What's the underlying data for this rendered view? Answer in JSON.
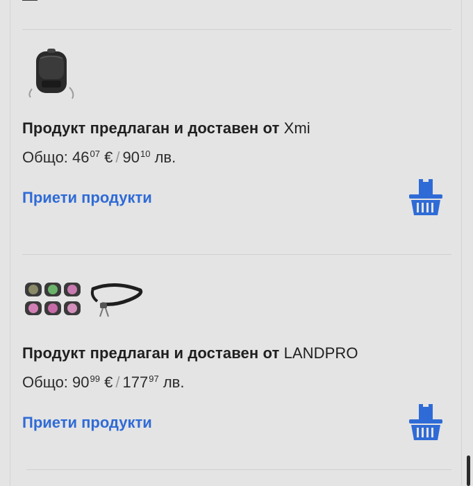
{
  "previous_item_text": "— ",
  "sellers": [
    {
      "label": "Продукт предлаган и доставен от",
      "name": "Xmi",
      "total_prefix": "Общо:",
      "eur_int": "46",
      "eur_dec": "07",
      "eur_sym": "€",
      "bgn_int": "90",
      "bgn_dec": "10",
      "bgn_sym": "лв.",
      "accept_label": "Приети продукти",
      "products": [
        "backpack"
      ]
    },
    {
      "label": "Продукт предлаган и доставен от",
      "name": "LANDPRO",
      "total_prefix": "Общо:",
      "eur_int": "90",
      "eur_dec": "99",
      "eur_sym": "€",
      "bgn_int": "177",
      "bgn_dec": "97",
      "bgn_sym": "лв.",
      "accept_label": "Приети продукти",
      "products": [
        "lens-filters-set",
        "lanyard-strap"
      ]
    }
  ],
  "icons": {
    "basket": "basket-icon",
    "chevron": "chevron-right-icon"
  },
  "colors": {
    "accent": "#2f6bd6",
    "background": "#e4e4e4",
    "divider": "#cfcfcf"
  }
}
